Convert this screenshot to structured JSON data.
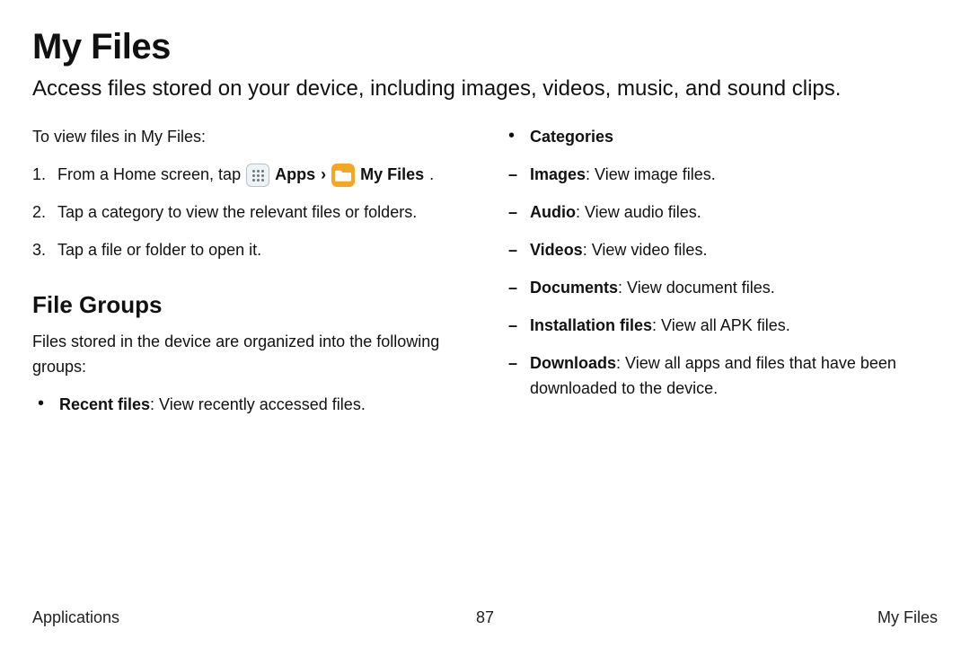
{
  "title": "My Files",
  "subtitle": "Access files stored on your device, including images, videos, music, and sound clips.",
  "left": {
    "lead": "To view files in My Files:",
    "step1_prefix": "From a Home screen, tap",
    "apps_label": "Apps",
    "chevron": "›",
    "myfiles_label": "My Files",
    "step1_suffix": ".",
    "step2": "Tap a category to view the relevant files or folders.",
    "step3": "Tap a file or folder to open it.",
    "h2": "File Groups",
    "para": "Files stored in the device are organized into the following groups:",
    "recent_bold": "Recent files",
    "recent_rest": ": View recently accessed files."
  },
  "right": {
    "categories_label": "Categories",
    "items": [
      {
        "bold": "Images",
        "rest": ": View image files."
      },
      {
        "bold": "Audio",
        "rest": ": View audio files."
      },
      {
        "bold": "Videos",
        "rest": ": View video files."
      },
      {
        "bold": "Documents",
        "rest": ": View document files."
      },
      {
        "bold": "Installation files",
        "rest": ": View all APK files."
      },
      {
        "bold": "Downloads",
        "rest": ": View all apps and files that have been downloaded to the device."
      }
    ]
  },
  "footer": {
    "left": "Applications",
    "center": "87",
    "right": "My Files"
  }
}
